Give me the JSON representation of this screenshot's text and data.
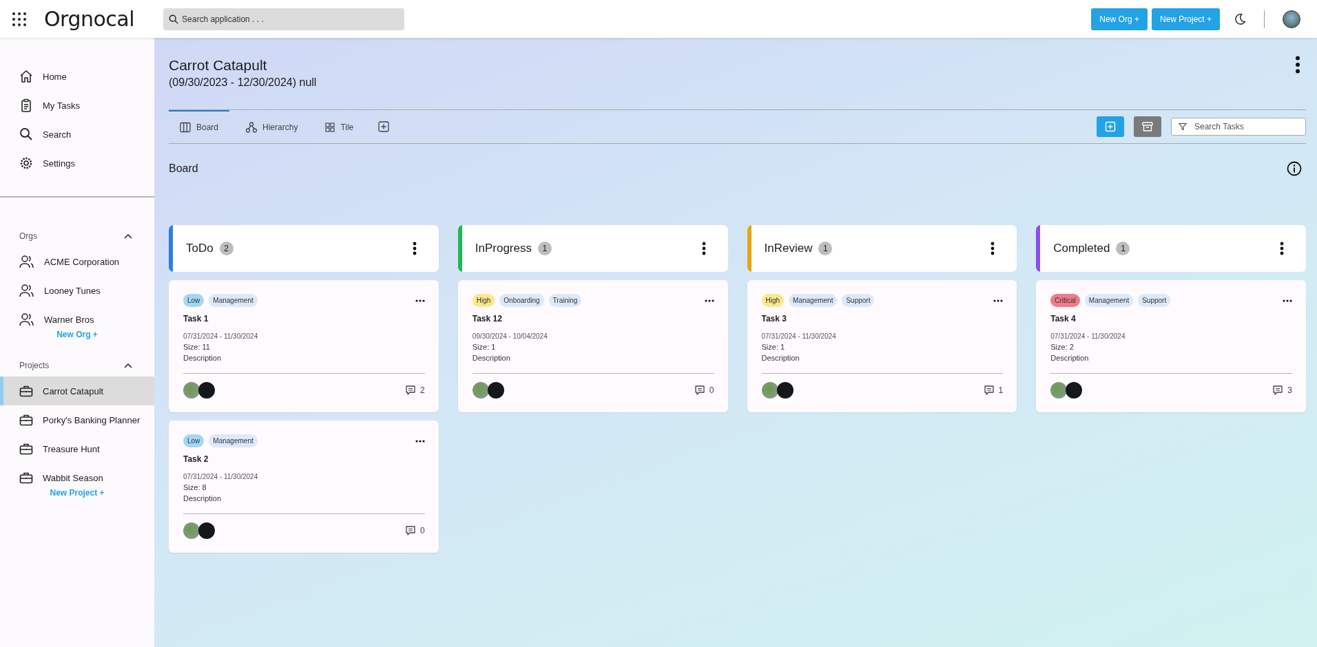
{
  "app": {
    "logo": "Orgnocal",
    "search_placeholder": "Search application . . .",
    "buttons": [
      "New Org +",
      "New Project +"
    ]
  },
  "sidebar": {
    "nav": [
      {
        "label": "Home",
        "kind": "home"
      },
      {
        "label": "My Tasks",
        "kind": "tasks"
      },
      {
        "label": "Search",
        "kind": "search"
      },
      {
        "label": "Settings",
        "kind": "settings"
      }
    ],
    "orgs": {
      "title": "Orgs",
      "expanded": true,
      "items": [
        {
          "label": "ACME Corporation"
        },
        {
          "label": "Looney Tunes"
        },
        {
          "label": "Warner Bros"
        }
      ],
      "add": "New Org +"
    },
    "projects": {
      "title": "Projects",
      "expanded": true,
      "items": [
        {
          "label": "Carrot Catapult",
          "selected": true
        },
        {
          "label": "Porky's Banking Planner",
          "selected": false
        },
        {
          "label": "Treasure Hunt",
          "selected": false
        },
        {
          "label": "Wabbit Season",
          "selected": false
        }
      ],
      "add": "New Project +"
    }
  },
  "project": {
    "title": "Carrot Catapult",
    "dates": "(09/30/2023 - 12/30/2024) null"
  },
  "tabs": [
    {
      "label": "Board",
      "selected": true,
      "kind": "board"
    },
    {
      "label": "Hierarchy",
      "selected": false,
      "kind": "hierarchy"
    },
    {
      "label": "Tile",
      "selected": false,
      "kind": "tile"
    }
  ],
  "task_search": {
    "placeholder": "Search Tasks"
  },
  "section_title": "Board",
  "columns": [
    {
      "title": "ToDo",
      "count": "2",
      "color": "#2f7de1",
      "cards": [
        {
          "tags": [
            {
              "label": "Low",
              "color": "#a3d8f4"
            },
            {
              "label": "Management",
              "color": "#dbe9fb"
            }
          ],
          "title": "Task 1",
          "dates": "07/31/2024 - 11/30/2024",
          "size": "Size: 11",
          "description": "Description",
          "comments": "2"
        },
        {
          "tags": [
            {
              "label": "Low",
              "color": "#a3d8f4"
            },
            {
              "label": "Management",
              "color": "#dbe9fb"
            }
          ],
          "title": "Task 2",
          "dates": "07/31/2024 - 11/30/2024",
          "size": "Size: 8",
          "description": "Description",
          "comments": "0"
        }
      ]
    },
    {
      "title": "InProgress",
      "count": "1",
      "color": "#1db954",
      "cards": [
        {
          "tags": [
            {
              "label": "High",
              "color": "#fbe98a"
            },
            {
              "label": "Onboarding",
              "color": "#dbe9fb"
            },
            {
              "label": "Training",
              "color": "#dbe9fb"
            }
          ],
          "title": "Task 12",
          "dates": "09/30/2024 - 10/04/2024",
          "size": "Size: 1",
          "description": "Description",
          "comments": "0"
        }
      ]
    },
    {
      "title": "InReview",
      "count": "1",
      "color": "#e8a514",
      "cards": [
        {
          "tags": [
            {
              "label": "High",
              "color": "#fbe98a"
            },
            {
              "label": "Management",
              "color": "#dbe9fb"
            },
            {
              "label": "Support",
              "color": "#dbe9fb"
            }
          ],
          "title": "Task 3",
          "dates": "07/31/2024 - 11/30/2024",
          "size": "Size: 1",
          "description": "Description",
          "comments": "1"
        }
      ]
    },
    {
      "title": "Completed",
      "count": "1",
      "color": "#8e4cf0",
      "cards": [
        {
          "tags": [
            {
              "label": "Critical",
              "color": "#f07b8a"
            },
            {
              "label": "Management",
              "color": "#dbe9fb"
            },
            {
              "label": "Support",
              "color": "#dbe9fb"
            }
          ],
          "title": "Task 4",
          "dates": "07/31/2024 - 11/30/2024",
          "size": "Size: 2",
          "description": "Description",
          "comments": "3"
        }
      ]
    }
  ]
}
